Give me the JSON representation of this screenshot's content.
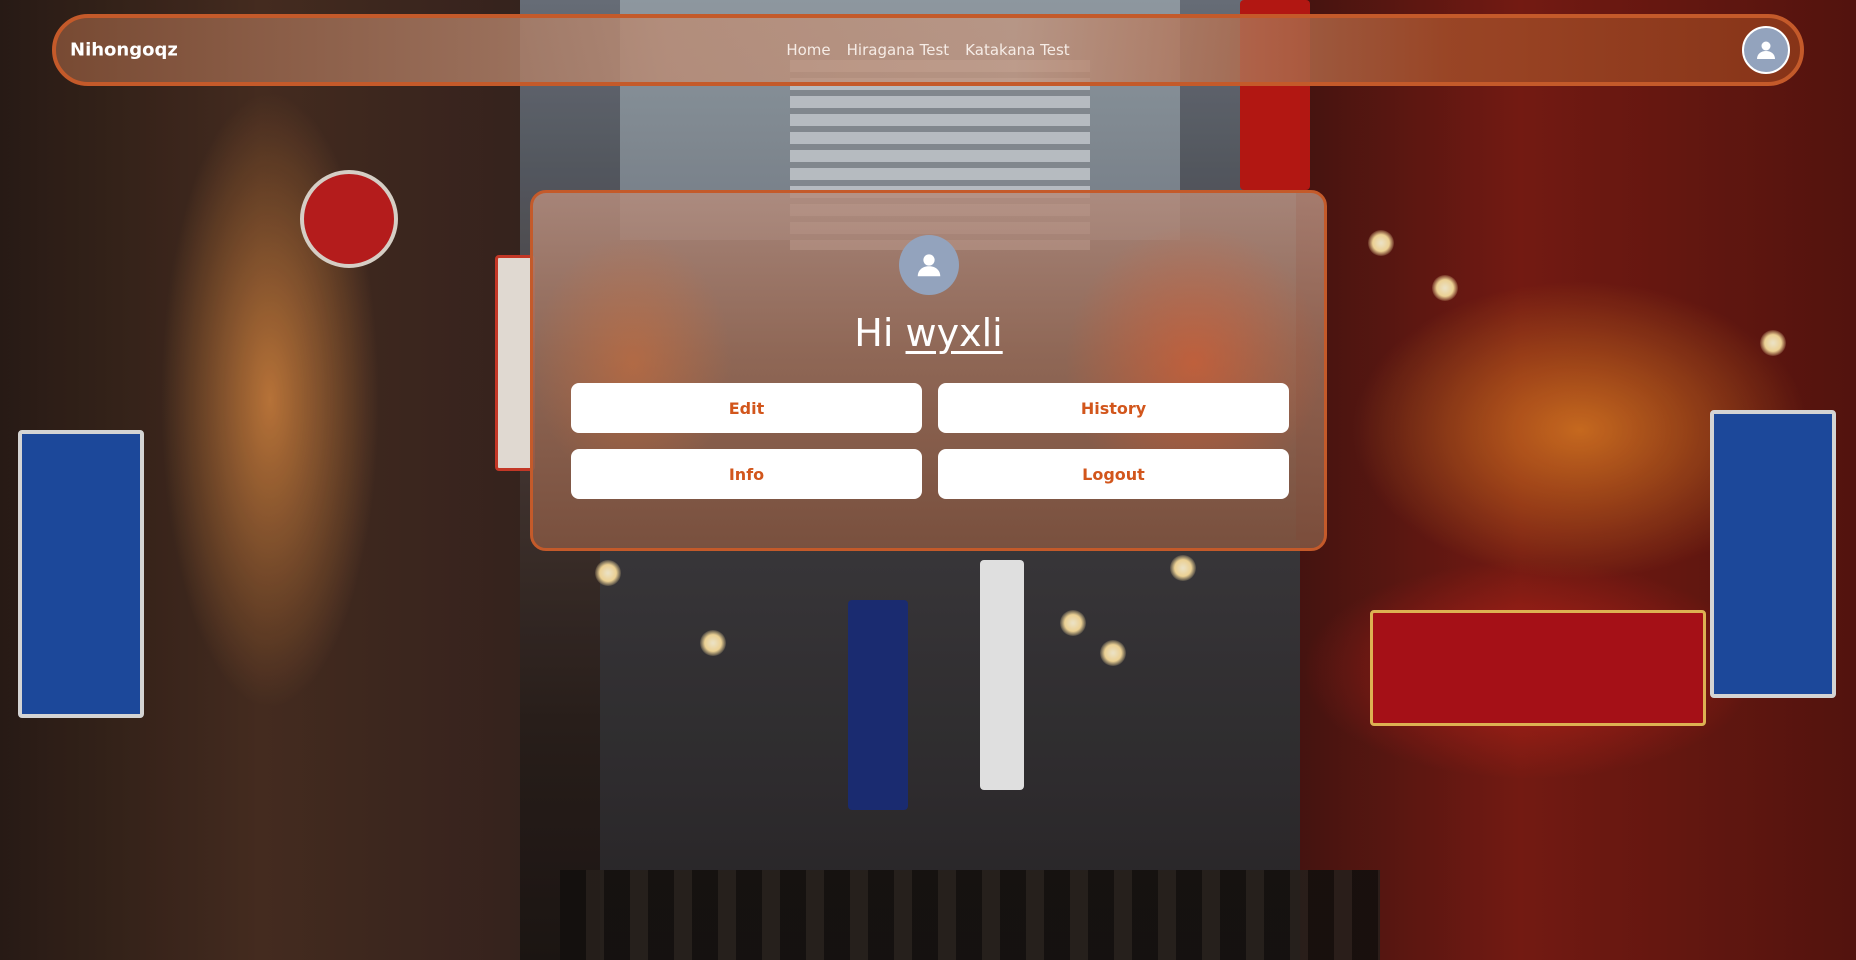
{
  "navbar": {
    "brand": "Nihongoqz",
    "links": [
      {
        "label": "Home"
      },
      {
        "label": "Hiragana Test"
      },
      {
        "label": "Katakana Test"
      }
    ],
    "avatar_icon": "user-avatar-icon"
  },
  "profile": {
    "greeting_prefix": "Hi",
    "username": "wyxli",
    "avatar_icon": "user-avatar-icon",
    "buttons": {
      "edit": "Edit",
      "history": "History",
      "info": "Info",
      "logout": "Logout"
    }
  },
  "colors": {
    "accent": "#c45a2a",
    "button_text": "#d2561c",
    "avatar_bg": "#93a3bd"
  }
}
